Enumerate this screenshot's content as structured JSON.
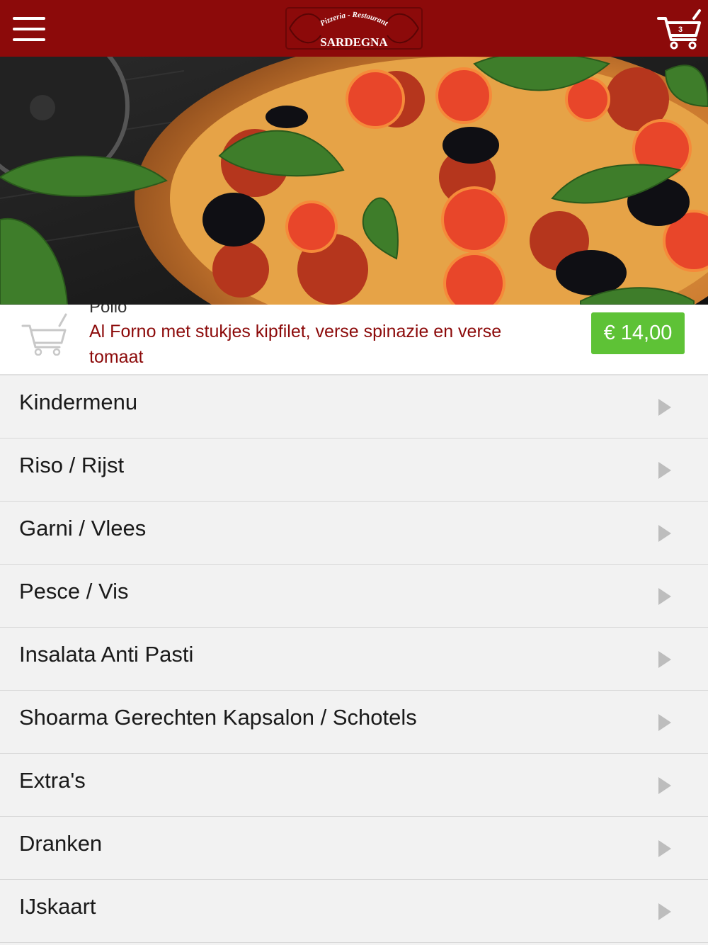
{
  "header": {
    "logo_top_text": "Pizzeria - Restaurant",
    "logo_name": "SARDEGNA",
    "cart_count": "3",
    "background_color": "#8c0a0a"
  },
  "hero": {
    "image_subject": "pizza-with-tomato-olives-basil"
  },
  "featured_item": {
    "name": "Pollo",
    "description": "Al Forno met stukjes kipfilet, verse spinazie en verse tomaat",
    "price": "€ 14,00",
    "price_color": "#5ec236"
  },
  "categories": [
    {
      "label": "Kindermenu"
    },
    {
      "label": "Riso / Rijst"
    },
    {
      "label": "Garni / Vlees"
    },
    {
      "label": "Pesce / Vis"
    },
    {
      "label": "Insalata Anti Pasti"
    },
    {
      "label": "Shoarma Gerechten Kapsalon / Schotels"
    },
    {
      "label": "Extra's"
    },
    {
      "label": "Dranken"
    },
    {
      "label": "IJskaart"
    }
  ]
}
